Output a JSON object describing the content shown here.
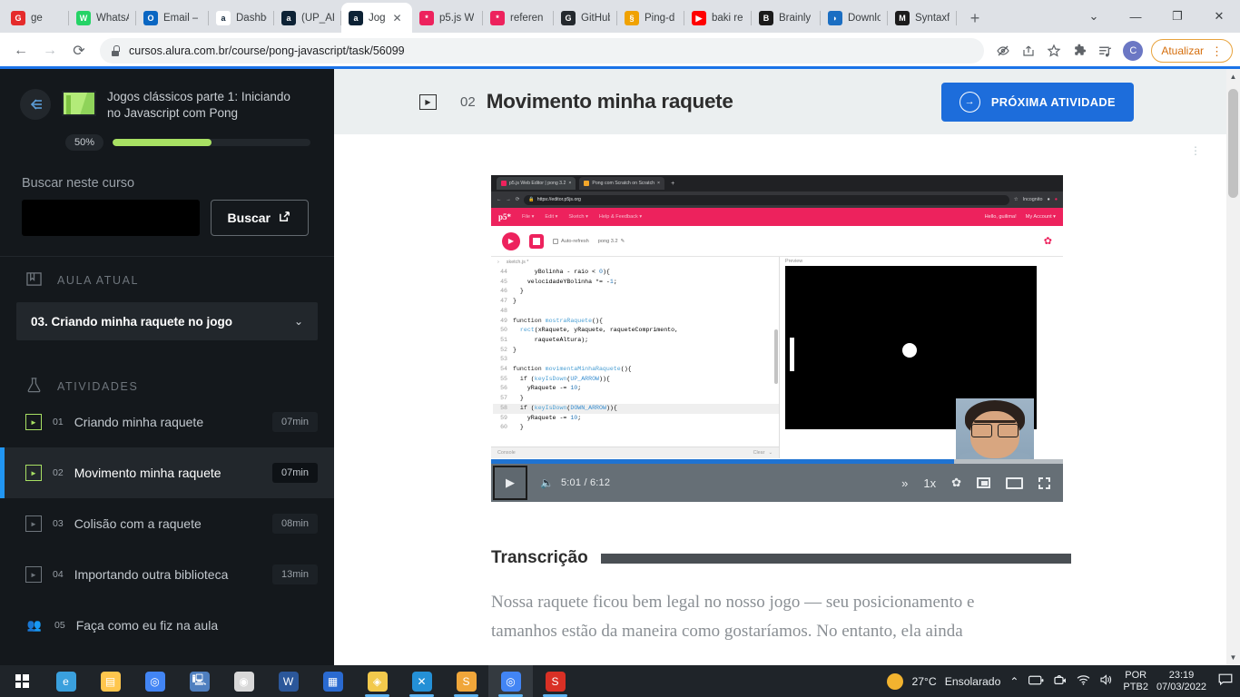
{
  "browser": {
    "tabs": [
      {
        "title": "ge",
        "favicon": "globo-icon",
        "color": "#e52b2b",
        "letter": "G",
        "active": false
      },
      {
        "title": "WhatsA",
        "favicon": "whatsapp-icon",
        "color": "#25d366",
        "letter": "W",
        "active": false
      },
      {
        "title": "Email –",
        "favicon": "outlook-icon",
        "color": "#0a66c2",
        "letter": "O",
        "active": false
      },
      {
        "title": "Dashbo",
        "favicon": "alura-icon",
        "color": "#ffffff",
        "letter": "a",
        "active": false
      },
      {
        "title": "(UP_AR",
        "favicon": "alura-icon",
        "color": "#0d2235",
        "letter": "a",
        "active": false
      },
      {
        "title": "Jog",
        "favicon": "alura-icon",
        "color": "#0d2235",
        "letter": "a",
        "active": true
      },
      {
        "title": "p5.js W",
        "favicon": "p5js-icon",
        "color": "#ed225d",
        "letter": "*",
        "active": false
      },
      {
        "title": "referen",
        "favicon": "p5js-icon",
        "color": "#ed225d",
        "letter": "*",
        "active": false
      },
      {
        "title": "GitHub",
        "favicon": "github-icon",
        "color": "#24292e",
        "letter": "G",
        "active": false
      },
      {
        "title": "Ping-d",
        "favicon": "pingdom-icon",
        "color": "#f0a202",
        "letter": "§",
        "active": false
      },
      {
        "title": "baki re",
        "favicon": "youtube-icon",
        "color": "#ff0000",
        "letter": "▶",
        "active": false
      },
      {
        "title": "Brainly",
        "favicon": "brainly-icon",
        "color": "#1b1b1b",
        "letter": "B",
        "active": false
      },
      {
        "title": "Downlo",
        "favicon": "download-icon",
        "color": "#1b6ec2",
        "letter": "◗",
        "active": false
      },
      {
        "title": "Syntaxf",
        "favicon": "syntax-icon",
        "color": "#1b1b1b",
        "letter": "M",
        "active": false
      }
    ],
    "new_tab_label": "+",
    "close_label": "✕",
    "window_controls": {
      "dropdown": "⌄",
      "minimize": "—",
      "maximize": "❐",
      "close": "✕"
    },
    "toolbar": {
      "back": "←",
      "forward": "→",
      "reload": "⟳",
      "url": "cursos.alura.com.br/course/pong-javascript/task/56099",
      "icons": [
        "eye-off-icon",
        "share-icon",
        "star-icon",
        "extensions-icon",
        "reading-list-icon"
      ],
      "avatar_letter": "C",
      "update_label": "Atualizar",
      "menu_label": "⋮"
    }
  },
  "sidebar": {
    "collapse_icon": "collapse-left-icon",
    "course_title": "Jogos clássicos parte 1: Iniciando no Javascript com Pong",
    "progress_percent": "50%",
    "progress_value": 50,
    "search_label": "Buscar neste curso",
    "search_value": "",
    "search_placeholder": "",
    "search_button": "Buscar",
    "current_lesson_section": "AULA ATUAL",
    "current_lesson": "03. Criando minha raquete no jogo",
    "activities_section": "ATIVIDADES",
    "activities": [
      {
        "num": "01",
        "label": "Criando minha raquete",
        "time": "07min",
        "icon": "video-icon",
        "done": true,
        "active": false
      },
      {
        "num": "02",
        "label": "Movimento minha raquete",
        "time": "07min",
        "icon": "video-icon",
        "done": true,
        "active": true
      },
      {
        "num": "03",
        "label": "Colisão com a raquete",
        "time": "08min",
        "icon": "video-icon",
        "done": false,
        "active": false
      },
      {
        "num": "04",
        "label": "Importando outra biblioteca",
        "time": "13min",
        "icon": "video-icon",
        "done": false,
        "active": false
      },
      {
        "num": "05",
        "label": "Faça como eu fiz na aula",
        "time": "",
        "icon": "people-icon",
        "done": false,
        "active": false
      }
    ]
  },
  "task": {
    "icon": "video-icon",
    "number": "02",
    "title": "Movimento minha raquete",
    "next_button": "PRÓXIMA ATIVIDADE",
    "next_icon": "arrow-right-circle-icon",
    "card_menu": "⋮"
  },
  "video": {
    "play_icon": "play-icon",
    "volume_icon": "volume-icon",
    "current_time": "5:01",
    "separator": "/",
    "duration": "6:12",
    "progress_percent": 81,
    "forward_icon": "fast-forward-icon",
    "speed": "1x",
    "settings_icon": "gear-icon",
    "pip_icon": "picture-in-picture-icon",
    "theater_icon": "theater-mode-icon",
    "fullscreen_icon": "fullscreen-icon",
    "screencast": {
      "tabs": [
        {
          "title": "p5.js Web Editor | pong 3.2",
          "active": true
        },
        {
          "title": "Pong com Scratch on Scratch",
          "active": false
        }
      ],
      "new_tab": "+",
      "close": "×",
      "nav": {
        "back": "←",
        "forward": "→",
        "reload": "⟳"
      },
      "url": "https://editor.p5js.org",
      "star": "☆",
      "incognito_label": "Incognito",
      "p5": {
        "logo": "p5*",
        "menus": [
          "File ▾",
          "Edit ▾",
          "Sketch ▾",
          "Help & Feedback ▾"
        ],
        "greeting": "Hello, guilima!",
        "account": "My Account ▾",
        "autorefresh": "Auto-refresh",
        "sketch_name": "pong 3.2",
        "pencil": "✎",
        "settings_icon": "gear-icon",
        "file_tab": "sketch.js *",
        "preview_label": "Preview",
        "console_label": "Console",
        "clear_label": "Clear"
      },
      "code_lines": [
        {
          "n": "44",
          "text": "      yBolinha - raio < 0){",
          "hl": false
        },
        {
          "n": "45",
          "text": "    velocidadeYBolinha *= -1;",
          "hl": false
        },
        {
          "n": "46",
          "text": "  }",
          "hl": false
        },
        {
          "n": "47",
          "text": "}",
          "hl": false
        },
        {
          "n": "48",
          "text": "",
          "hl": false
        },
        {
          "n": "49",
          "text": "function mostraRaquete(){",
          "hl": false
        },
        {
          "n": "50",
          "text": "  rect(xRaquete, yRaquete, raqueteComprimento,",
          "hl": false
        },
        {
          "n": "51",
          "text": "      raqueteAltura);",
          "hl": false
        },
        {
          "n": "52",
          "text": "}",
          "hl": false
        },
        {
          "n": "53",
          "text": "",
          "hl": false
        },
        {
          "n": "54",
          "text": "function movimentaMinhaRaquete(){",
          "hl": false
        },
        {
          "n": "55",
          "text": "  if (keyIsDown(UP_ARROW)){",
          "hl": false
        },
        {
          "n": "56",
          "text": "    yRaquete -= 10;",
          "hl": false
        },
        {
          "n": "57",
          "text": "  }",
          "hl": false
        },
        {
          "n": "58",
          "text": "  if (keyIsDown(DOWN_ARROW)){",
          "hl": true
        },
        {
          "n": "59",
          "text": "    yRaquete -= 10;",
          "hl": false
        },
        {
          "n": "60",
          "text": "  }",
          "hl": false
        }
      ]
    }
  },
  "transcription": {
    "heading": "Transcrição",
    "paragraph": "Nossa raquete ficou bem legal no nosso jogo — seu posicionamento e tamanhos estão da maneira como gostaríamos. No entanto, ela ainda"
  },
  "taskbar": {
    "start_icon": "windows-start-icon",
    "apps": [
      {
        "name": "edge-icon",
        "color": "#3aa0dd",
        "letter": "e",
        "active": false,
        "running": false
      },
      {
        "name": "explorer-icon",
        "color": "#ffc64d",
        "letter": "▤",
        "active": false,
        "running": false
      },
      {
        "name": "chrome-icon",
        "color": "#4285f4",
        "letter": "◎",
        "active": false,
        "running": false
      },
      {
        "name": "remote-desktop-icon",
        "color": "#4f7fbf",
        "letter": "🖳",
        "active": false,
        "running": false
      },
      {
        "name": "obs-icon",
        "color": "#d8d8d8",
        "letter": "◉",
        "active": false,
        "running": false
      },
      {
        "name": "word-icon",
        "color": "#2b579a",
        "letter": "W",
        "active": false,
        "running": false
      },
      {
        "name": "display-icon",
        "color": "#2a6ad0",
        "letter": "▦",
        "active": false,
        "running": false
      },
      {
        "name": "paint-3d-icon",
        "color": "#f2c94c",
        "letter": "◈",
        "active": false,
        "running": true
      },
      {
        "name": "vscode-icon",
        "color": "#2490d6",
        "letter": "✕",
        "active": false,
        "running": true
      },
      {
        "name": "sublime-icon",
        "color": "#f0a63a",
        "letter": "S",
        "active": false,
        "running": true
      },
      {
        "name": "chrome-active-icon",
        "color": "#4285f4",
        "letter": "◎",
        "active": true,
        "running": true
      },
      {
        "name": "autohotkey-icon",
        "color": "#d93025",
        "letter": "S",
        "active": false,
        "running": true
      }
    ],
    "weather_temp": "27°C",
    "weather_desc": "Ensolarado",
    "chevron": "⌃",
    "tray_icons": [
      "battery-icon",
      "camera-icon",
      "wifi-icon",
      "volume-icon"
    ],
    "lang_line1": "POR",
    "lang_line2": "PTB2",
    "time": "23:19",
    "date": "07/03/2022",
    "notification_icon": "notification-icon"
  }
}
